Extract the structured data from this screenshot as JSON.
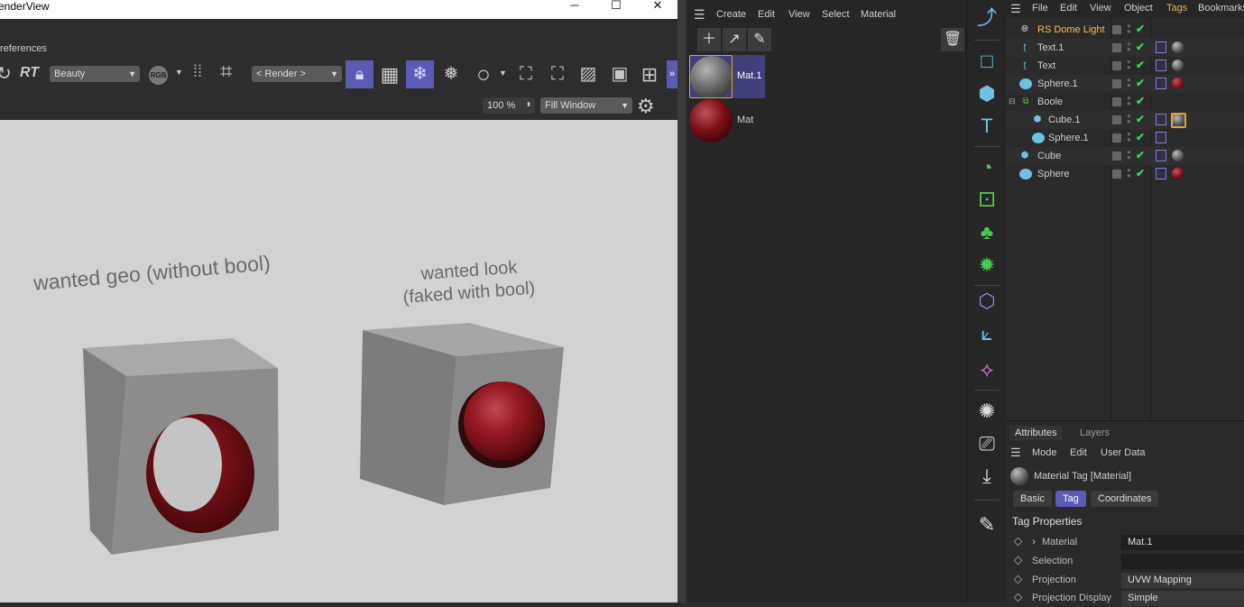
{
  "render_view": {
    "title": "enderView",
    "window_controls": {
      "minimize": "─",
      "maximize": "☐",
      "close": "✕"
    },
    "preferences_label": "references",
    "rt_label": "RT",
    "channel_select": "Beauty",
    "rgb_label": "RGB",
    "render_select": "< Render >",
    "zoom_value": "100 %",
    "fit_select": "Fill Window",
    "annotation_left": "wanted geo  (without  bool)",
    "annotation_right_line1": "wanted look",
    "annotation_right_line2": "(faked with bool)"
  },
  "material_manager": {
    "menu": [
      "Create",
      "Edit",
      "View",
      "Select",
      "Material"
    ],
    "materials": [
      {
        "name": "Mat.1",
        "color": "#6b6b6b",
        "selected": true
      },
      {
        "name": "Mat",
        "color": "#7a0f14",
        "selected": false
      }
    ]
  },
  "object_manager": {
    "menu": [
      "File",
      "Edit",
      "View",
      "Object",
      "Tags",
      "Bookmarks"
    ],
    "active_menu": "Tags",
    "objects": [
      {
        "name": "RS Dome Light",
        "icon": "globe-icon",
        "highlight": true
      },
      {
        "name": "Text.1",
        "icon": "text-spline-icon"
      },
      {
        "name": "Text",
        "icon": "text-spline-icon"
      },
      {
        "name": "Sphere.1",
        "icon": "sphere-icon"
      },
      {
        "name": "Boole",
        "icon": "boole-icon"
      },
      {
        "name": "Cube.1",
        "icon": "cube-icon"
      },
      {
        "name": "Sphere.1",
        "icon": "sphere-icon"
      },
      {
        "name": "Cube",
        "icon": "cube-icon"
      },
      {
        "name": "Sphere",
        "icon": "sphere-icon"
      }
    ]
  },
  "attributes": {
    "tabs": [
      "Attributes",
      "Layers"
    ],
    "menu": [
      "Mode",
      "Edit",
      "User Data"
    ],
    "header": "Material Tag [Material]",
    "pills": [
      "Basic",
      "Tag",
      "Coordinates"
    ],
    "active_pill": "Tag",
    "section": "Tag Properties",
    "properties": [
      {
        "label": "Material",
        "value": "Mat.1",
        "expander": "›"
      },
      {
        "label": "Selection",
        "value": ""
      },
      {
        "label": "Projection",
        "value": "UVW Mapping"
      },
      {
        "label": "Projection Display",
        "value": "Simple"
      }
    ]
  },
  "colors": {
    "accent_blue": "#5b5bb5",
    "dome_light_text": "#f4c045",
    "check_green": "#3fd15a",
    "toolbar_icon": "#6ec1e4"
  }
}
